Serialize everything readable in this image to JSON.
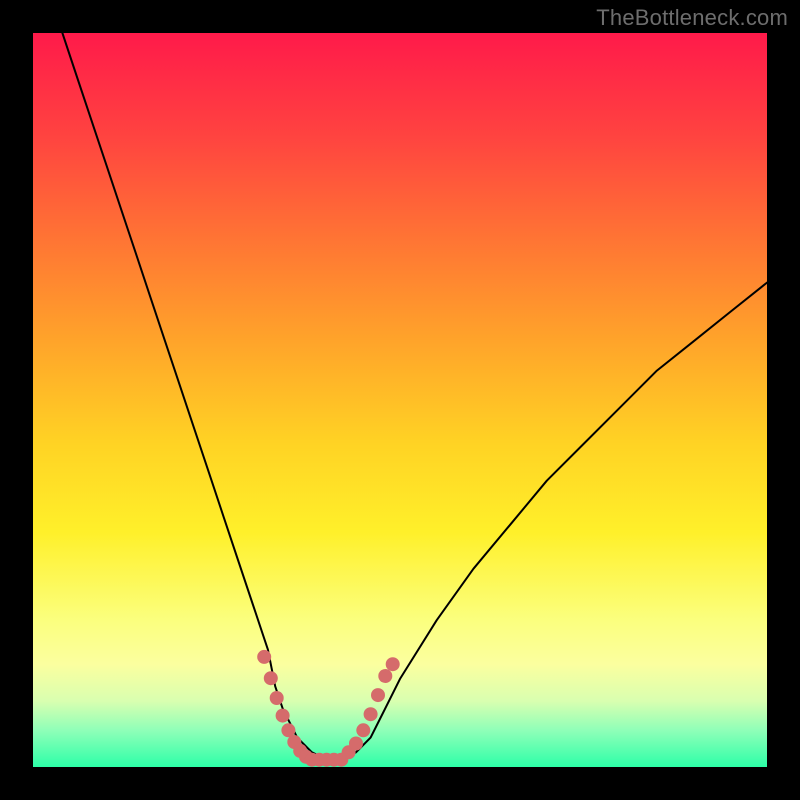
{
  "watermark": "TheBottleneck.com",
  "chart_data": {
    "type": "line",
    "title": "",
    "xlabel": "",
    "ylabel": "",
    "xlim": [
      0,
      100
    ],
    "ylim": [
      0,
      100
    ],
    "grid": false,
    "legend": false,
    "series": [
      {
        "name": "bottleneck-curve",
        "color": "#000000",
        "x": [
          4,
          6,
          8,
          10,
          12,
          14,
          16,
          18,
          20,
          22,
          24,
          26,
          28,
          30,
          32,
          33,
          34,
          36,
          38,
          40,
          42,
          44,
          46,
          48,
          50,
          55,
          60,
          65,
          70,
          75,
          80,
          85,
          90,
          95,
          100
        ],
        "y": [
          100,
          94,
          88,
          82,
          76,
          70,
          64,
          58,
          52,
          46,
          40,
          34,
          28,
          22,
          16,
          11,
          8,
          4,
          2,
          1,
          1,
          2,
          4,
          8,
          12,
          20,
          27,
          33,
          39,
          44,
          49,
          54,
          58,
          62,
          66
        ]
      }
    ],
    "markers": [
      {
        "name": "highlight-left",
        "color": "#d56b6b",
        "x": [
          31.5,
          32.4,
          33.2,
          34.0,
          34.8,
          35.6,
          36.4,
          37.2
        ],
        "y": [
          15,
          12.1,
          9.4,
          7.0,
          5.0,
          3.4,
          2.2,
          1.4
        ]
      },
      {
        "name": "highlight-bottom",
        "color": "#d56b6b",
        "x": [
          38,
          39,
          40,
          41,
          42
        ],
        "y": [
          1,
          1,
          1,
          1,
          1
        ]
      },
      {
        "name": "highlight-right",
        "color": "#d56b6b",
        "x": [
          43,
          44,
          45,
          46,
          47,
          48,
          49
        ],
        "y": [
          2.0,
          3.2,
          5.0,
          7.2,
          9.8,
          12.4,
          14.0
        ]
      }
    ]
  }
}
